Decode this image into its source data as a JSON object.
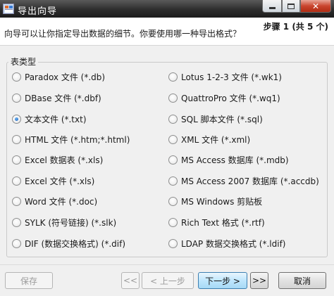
{
  "window": {
    "title": "导出向导"
  },
  "header": {
    "prompt": "向导可以让你指定导出数据的细节。你要使用哪一种导出格式？",
    "step": "步骤 1 (共 5 个)"
  },
  "group": {
    "label": "表类型",
    "options": [
      {
        "label": "Paradox 文件 (*.db)",
        "checked": false
      },
      {
        "label": "Lotus 1-2-3 文件 (*.wk1)",
        "checked": false
      },
      {
        "label": "DBase 文件 (*.dbf)",
        "checked": false
      },
      {
        "label": "QuattroPro 文件 (*.wq1)",
        "checked": false
      },
      {
        "label": "文本文件 (*.txt)",
        "checked": true
      },
      {
        "label": "SQL 脚本文件 (*.sql)",
        "checked": false
      },
      {
        "label": "HTML 文件 (*.htm;*.html)",
        "checked": false
      },
      {
        "label": "XML 文件 (*.xml)",
        "checked": false
      },
      {
        "label": "Excel 数据表 (*.xls)",
        "checked": false
      },
      {
        "label": "MS Access 数据库 (*.mdb)",
        "checked": false
      },
      {
        "label": "Excel 文件 (*.xls)",
        "checked": false
      },
      {
        "label": "MS Access 2007 数据库 (*.accdb)",
        "checked": false
      },
      {
        "label": "Word 文件 (*.doc)",
        "checked": false
      },
      {
        "label": "MS Windows 剪贴板",
        "checked": false
      },
      {
        "label": "SYLK (符号链接) (*.slk)",
        "checked": false
      },
      {
        "label": "Rich Text 格式 (*.rtf)",
        "checked": false
      },
      {
        "label": "DIF (数据交换格式) (*.dif)",
        "checked": false
      },
      {
        "label": "LDAP 数据交换格式 (*.ldif)",
        "checked": false
      }
    ]
  },
  "buttons": {
    "save": "保存",
    "first": "<<",
    "prev": "< 上一步",
    "next": "下一步 >",
    "last": ">>",
    "cancel": "取消"
  },
  "colors": {
    "accent": "#1b5fb8",
    "titlebar": "#2d2d2d"
  }
}
